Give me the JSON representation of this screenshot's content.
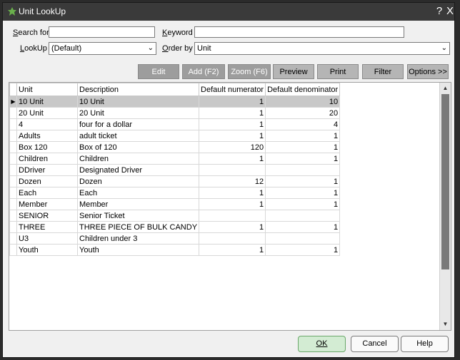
{
  "window": {
    "title": "Unit LookUp",
    "help_glyph": "?",
    "close_glyph": "X"
  },
  "filters": {
    "search_for_label": "Search for",
    "search_for_value": "",
    "keyword_label": "Keyword",
    "keyword_value": "",
    "lookup_label": "LookUp",
    "lookup_value": "(Default)",
    "order_by_label": "Order by",
    "order_by_value": "Unit"
  },
  "toolbar": {
    "edit": "Edit",
    "add": "Add (F2)",
    "zoom": "Zoom (F6)",
    "preview": "Preview",
    "print": "Print",
    "filter": "Filter",
    "options": "Options >>"
  },
  "grid": {
    "columns": [
      "Unit",
      "Description",
      "Default numerator",
      "Default denominator"
    ],
    "rows": [
      {
        "unit": "10 Unit",
        "description": "10 Unit",
        "numerator": "1",
        "denominator": "10"
      },
      {
        "unit": "20 Unit",
        "description": "20 Unit",
        "numerator": "1",
        "denominator": "20"
      },
      {
        "unit": "4",
        "description": "four for a dollar",
        "numerator": "1",
        "denominator": "4"
      },
      {
        "unit": "Adults",
        "description": "adult ticket",
        "numerator": "1",
        "denominator": "1"
      },
      {
        "unit": "Box 120",
        "description": "Box of 120",
        "numerator": "120",
        "denominator": "1"
      },
      {
        "unit": "Children",
        "description": "Children",
        "numerator": "1",
        "denominator": "1"
      },
      {
        "unit": "DDriver",
        "description": "Designated Driver",
        "numerator": "",
        "denominator": ""
      },
      {
        "unit": "Dozen",
        "description": "Dozen",
        "numerator": "12",
        "denominator": "1"
      },
      {
        "unit": "Each",
        "description": "Each",
        "numerator": "1",
        "denominator": "1"
      },
      {
        "unit": "Member",
        "description": "Member",
        "numerator": "1",
        "denominator": "1"
      },
      {
        "unit": "SENIOR",
        "description": "Senior Ticket",
        "numerator": "",
        "denominator": ""
      },
      {
        "unit": "THREE",
        "description": "THREE PIECE OF BULK CANDY",
        "numerator": "1",
        "denominator": "1"
      },
      {
        "unit": "U3",
        "description": "Children under 3",
        "numerator": "",
        "denominator": ""
      },
      {
        "unit": "Youth",
        "description": "Youth",
        "numerator": "1",
        "denominator": "1"
      }
    ],
    "selected_row": 0
  },
  "footer": {
    "ok": "OK",
    "cancel": "Cancel",
    "help": "Help"
  },
  "colors": {
    "titlebar": "#3a3a3a",
    "accent_green": "#6aa86a",
    "toolbar_button": "#9d9d9d"
  }
}
